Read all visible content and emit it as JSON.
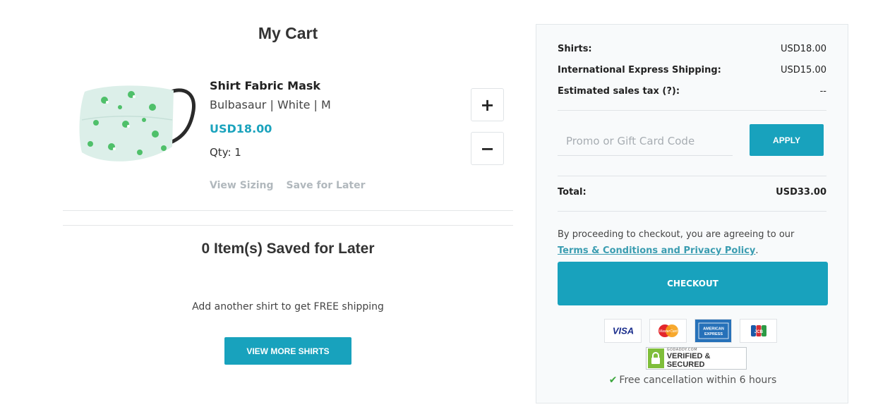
{
  "cart": {
    "title": "My Cart",
    "item": {
      "name": "Shirt Fabric Mask",
      "variant": "Bulbasaur | White | M",
      "price": "USD18.00",
      "qty_label": "Qty: 1",
      "view_sizing": "View Sizing",
      "save_for_later": "Save for Later",
      "plus_label": "+",
      "minus_label": "−"
    },
    "saved_title": "0 Item(s) Saved for Later",
    "free_shipping_text": "Add another shirt to get FREE shipping",
    "view_more_label": "VIEW MORE SHIRTS"
  },
  "summary": {
    "shirts_label": "Shirts:",
    "shirts_value": "USD18.00",
    "shipping_label": "International Express Shipping:",
    "shipping_value": "USD15.00",
    "tax_label": "Estimated sales tax (?):",
    "tax_value": "--",
    "promo_placeholder": "Promo or Gift Card Code",
    "apply_label": "APPLY",
    "total_label": "Total:",
    "total_value": "USD33.00",
    "agree_text": "By proceeding to checkout, you are agreeing to our",
    "terms_link": "Terms & Conditions and Privacy Policy",
    "period": ".",
    "checkout_label": "CHECKOUT",
    "cards": {
      "visa": "VISA",
      "mastercard": "MasterCard",
      "amex": "AMERICAN EXPRESS",
      "jcb": "JCB"
    },
    "secured_small": "GODADDY.COM",
    "secured_big": "VERIFIED & SECURED",
    "cancellation_text": "Free cancellation within 6 hours"
  },
  "colors": {
    "accent": "#18a2bd",
    "price": "#1ba3bd",
    "link": "#3b9db1",
    "check": "#3ba53b"
  }
}
